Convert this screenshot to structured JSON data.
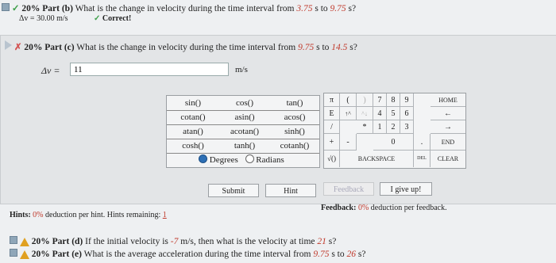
{
  "part_b": {
    "pct": "20%",
    "label": "Part (b)",
    "question": "What is the change in velocity during the time interval from",
    "t1": "3.75",
    "to_word": "s to",
    "t2": "9.75",
    "end": "s?",
    "answer": "Δv = 30.00 m/s",
    "status": "Correct!"
  },
  "part_c": {
    "pct": "20%",
    "label": "Part (c)",
    "question": "What is the change in velocity during the time interval from",
    "t1": "9.75",
    "to_word": "s to",
    "t2": "14.5",
    "end": "s?",
    "var_label": "Δv =",
    "input_value": "11",
    "unit": "m/s"
  },
  "functions": [
    [
      "sin()",
      "cos()",
      "tan()"
    ],
    [
      "cotan()",
      "asin()",
      "acos()"
    ],
    [
      "atan()",
      "acotan()",
      "sinh()"
    ],
    [
      "cosh()",
      "tanh()",
      "cotanh()"
    ]
  ],
  "angle_mode": {
    "degrees": "Degrees",
    "radians": "Radians",
    "selected": "Degrees"
  },
  "keypad": {
    "row1": [
      "π",
      "(",
      ")",
      "7",
      "8",
      "9",
      "HOME"
    ],
    "row2": [
      "E",
      "↑^",
      "^↓",
      "4",
      "5",
      "6",
      "←"
    ],
    "row3": [
      "/",
      "*",
      "1",
      "2",
      "3",
      "→"
    ],
    "row4": [
      "+",
      "-",
      "0",
      ".",
      "END"
    ],
    "row5": [
      "√()",
      "BACKSPACE",
      "DEL",
      "CLEAR"
    ]
  },
  "buttons": {
    "submit": "Submit",
    "hint": "Hint",
    "feedback": "Feedback",
    "give_up": "I give up!"
  },
  "hints": {
    "label": "Hints:",
    "pct": "0%",
    "text": "deduction per hint. Hints remaining:",
    "remaining": "1"
  },
  "feedback": {
    "label": "Feedback:",
    "pct": "0%",
    "text": "deduction per feedback."
  },
  "part_d": {
    "pct": "20%",
    "label": "Part (d)",
    "q1": "If the initial velocity is",
    "v": "-7",
    "q2": "m/s, then what is the velocity at time",
    "t": "21",
    "q3": "s?"
  },
  "part_e": {
    "pct": "20%",
    "label": "Part (e)",
    "q1": "What is the average acceleration during the time interval from",
    "t1": "9.75",
    "q2": "s to",
    "t2": "26",
    "q3": "s?"
  },
  "colors": {
    "accent_red": "#c0392b",
    "check_green": "#3fa04a"
  }
}
